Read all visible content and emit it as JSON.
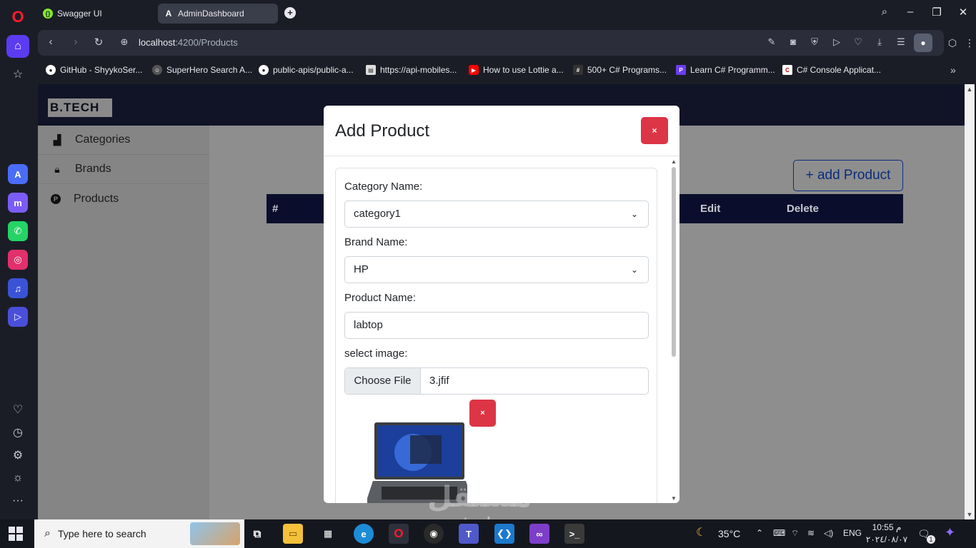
{
  "browser": {
    "tabs": [
      {
        "label": "Swagger UI",
        "active": false
      },
      {
        "label": "AdminDashboard",
        "active": true
      }
    ],
    "url_host": "localhost",
    "url_path": ":4200/Products",
    "bookmarks": [
      "GitHub - ShyykoSer...",
      "SuperHero Search A...",
      "public-apis/public-a...",
      "https://api-mobiles...",
      "How to use Lottie a...",
      "500+ C# Programs...",
      "Learn C# Programm...",
      "C# Console Applicat..."
    ]
  },
  "app": {
    "logo": "B.TECH",
    "sidebar": [
      {
        "label": "Categories",
        "icon": "chart-icon"
      },
      {
        "label": "Brands",
        "icon": "lock-icon"
      },
      {
        "label": "Products",
        "icon": "p-circle-icon"
      }
    ],
    "add_button": "+ add Product",
    "table_headers": [
      "#",
      "Edit",
      "Delete"
    ]
  },
  "modal": {
    "title": "Add Product",
    "close_label": "×",
    "category_label": "Category Name:",
    "category_value": "category1",
    "brand_label": "Brand Name:",
    "brand_value": "HP",
    "product_label": "Product Name:",
    "product_value": "labtop",
    "image_label": "select image:",
    "file_button": "Choose File",
    "file_name": "3.jfif",
    "remove_label": "×"
  },
  "watermark": {
    "arabic": "مستقل",
    "latin": "mostaql.com"
  },
  "taskbar": {
    "search_placeholder": "Type here to search",
    "weather": "35°C",
    "lang": "ENG",
    "time": "10:55 م",
    "date": "٢٠٢٤/٠٨/٠٧",
    "notifications": "1"
  },
  "colors": {
    "accent": "#5b3cf0",
    "danger": "#dc3545",
    "header_dark": "#101426",
    "table_head": "#0a0e2c",
    "link_blue": "#0a2c7d"
  }
}
